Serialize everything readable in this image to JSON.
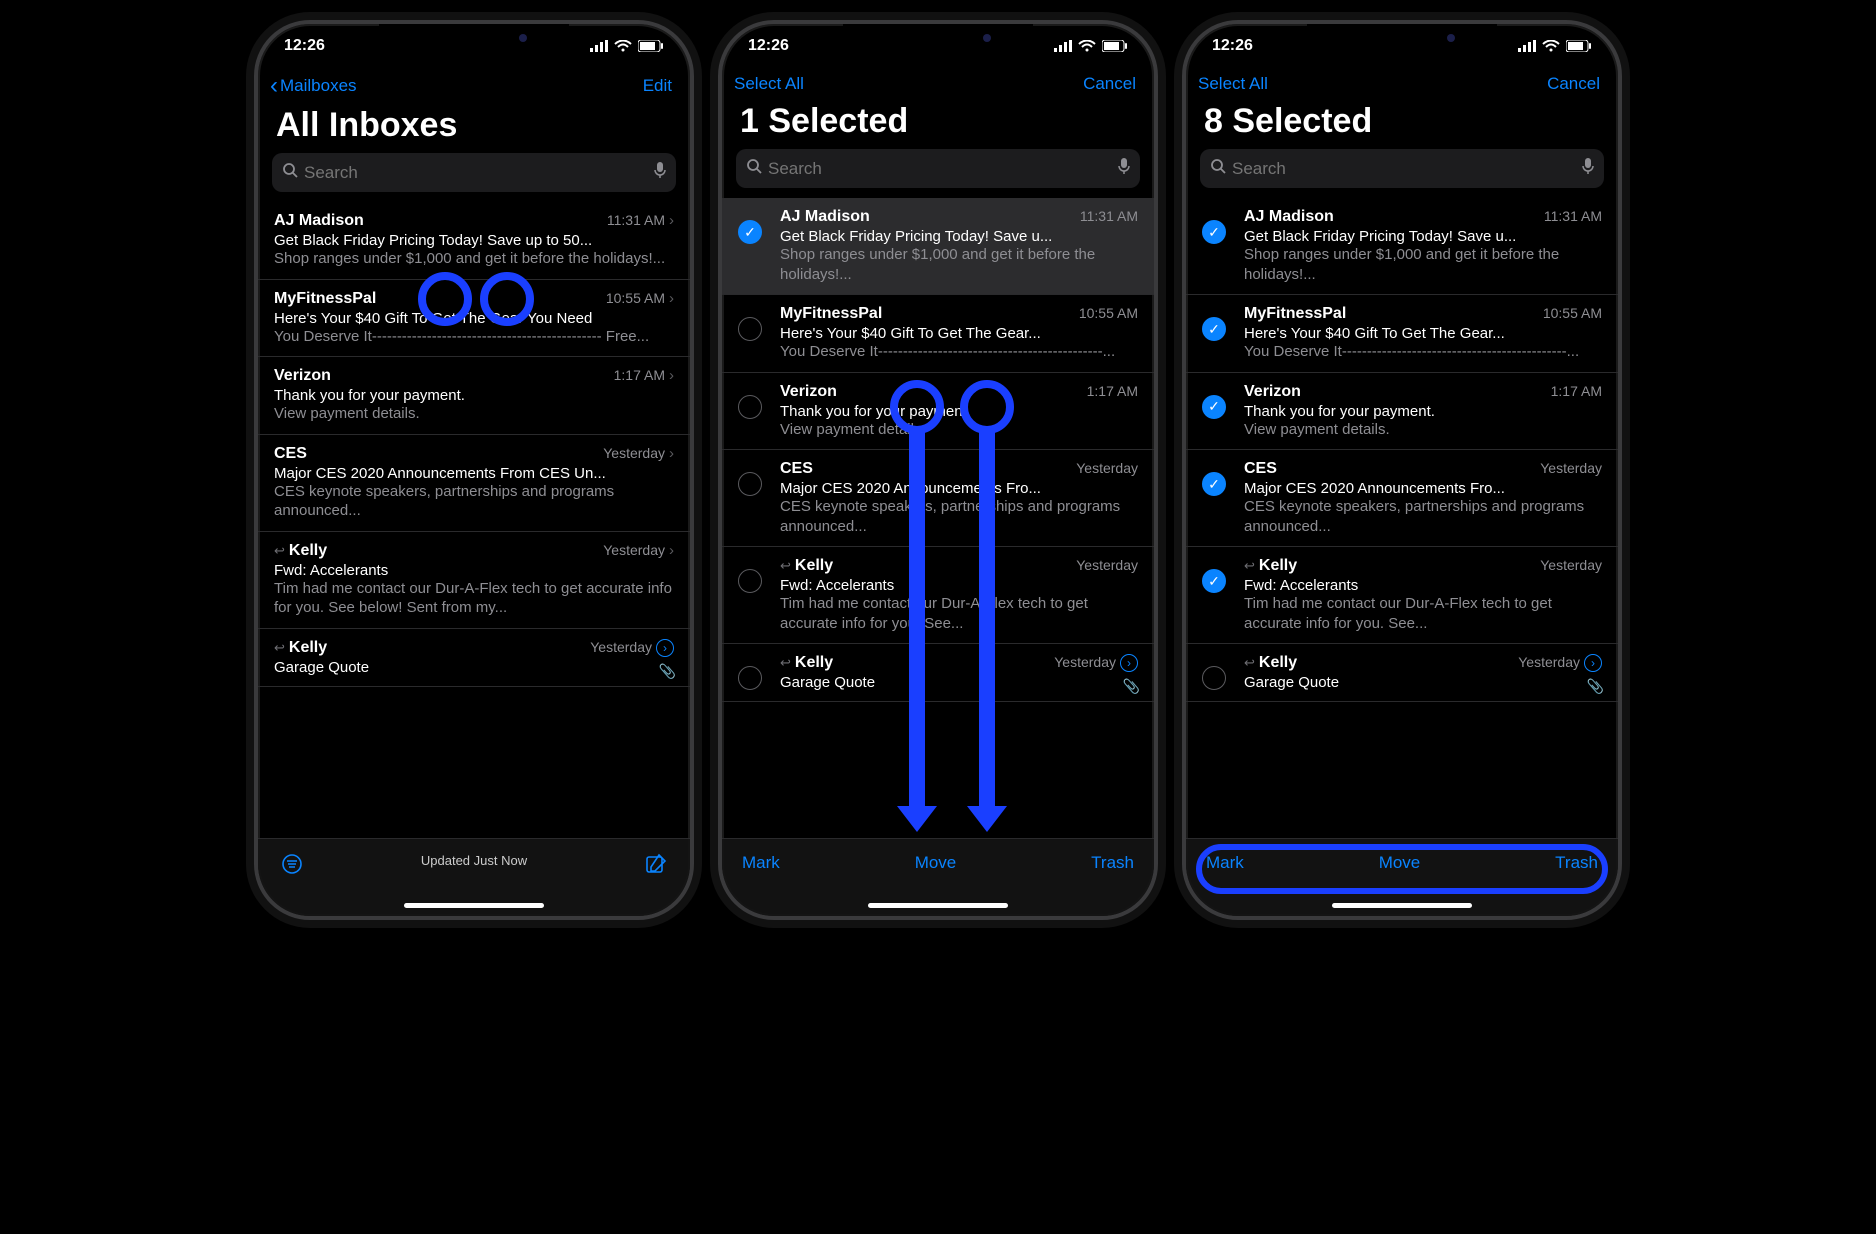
{
  "status": {
    "time": "12:26"
  },
  "search_placeholder": "Search",
  "phones": [
    {
      "nav": {
        "back": "Mailboxes",
        "right": "Edit",
        "show_chevron": true
      },
      "title": "All Inboxes",
      "mode": "browse",
      "toolbar": {
        "type": "status",
        "status": "Updated Just Now"
      },
      "annotations": {
        "two_circles": true
      },
      "emails": [
        {
          "sender": "AJ Madison",
          "time": "11:31 AM",
          "subject": "Get Black Friday Pricing Today! Save up to 50...",
          "preview": "Shop ranges under $1,000 and get it before the holidays!...",
          "disclosure": true
        },
        {
          "sender": "MyFitnessPal",
          "time": "10:55 AM",
          "subject": "Here's Your $40 Gift To Get The Gear You Need",
          "preview": "You Deserve It---------------------------------------------- Free...",
          "disclosure": true
        },
        {
          "sender": "Verizon",
          "time": "1:17 AM",
          "subject": "Thank you for your payment.",
          "preview": "View payment details.",
          "disclosure": true
        },
        {
          "sender": "CES",
          "time": "Yesterday",
          "subject": "Major CES 2020 Announcements From CES Un...",
          "preview": "CES keynote speakers, partnerships and programs announced...",
          "disclosure": true
        },
        {
          "sender": "Kelly",
          "time": "Yesterday",
          "subject": "Fwd: Accelerants",
          "preview": "Tim had me contact our Dur-A-Flex tech to get accurate info for you. See below! Sent from my...",
          "disclosure": true,
          "reply": true
        },
        {
          "sender": "Kelly",
          "time": "Yesterday",
          "subject": "Garage Quote",
          "preview": "",
          "thread": true,
          "reply": true,
          "attach": true
        }
      ]
    },
    {
      "nav": {
        "back": "Select All",
        "right": "Cancel",
        "show_chevron": false
      },
      "title": "1 Selected",
      "mode": "select",
      "toolbar": {
        "type": "actions",
        "left": "Mark",
        "center": "Move",
        "right": "Trash"
      },
      "annotations": {
        "two_arrows": true
      },
      "emails": [
        {
          "sender": "AJ Madison",
          "time": "11:31 AM",
          "subject": "Get Black Friday Pricing Today! Save u...",
          "preview": "Shop ranges under $1,000 and get it before the holidays!...",
          "checked": true,
          "highlight": true
        },
        {
          "sender": "MyFitnessPal",
          "time": "10:55 AM",
          "subject": "Here's Your $40 Gift To Get The Gear...",
          "preview": "You Deserve It---------------------------------------------...",
          "checked": false
        },
        {
          "sender": "Verizon",
          "time": "1:17 AM",
          "subject": "Thank you for your payment.",
          "preview": "View payment details.",
          "checked": false
        },
        {
          "sender": "CES",
          "time": "Yesterday",
          "subject": "Major CES 2020 Announcements Fro...",
          "preview": "CES keynote speakers, partnerships and programs announced...",
          "checked": false
        },
        {
          "sender": "Kelly",
          "time": "Yesterday",
          "subject": "Fwd: Accelerants",
          "preview": "Tim had me contact our Dur-A-Flex tech to get accurate info for you. See...",
          "checked": false,
          "reply": true
        },
        {
          "sender": "Kelly",
          "time": "Yesterday",
          "subject": "Garage Quote",
          "preview": "",
          "thread": true,
          "reply": true,
          "attach": true
        }
      ]
    },
    {
      "nav": {
        "back": "Select All",
        "right": "Cancel",
        "show_chevron": false
      },
      "title": "8 Selected",
      "mode": "select",
      "toolbar": {
        "type": "actions",
        "left": "Mark",
        "center": "Move",
        "right": "Trash"
      },
      "annotations": {
        "toolbar_pill": true
      },
      "emails": [
        {
          "sender": "AJ Madison",
          "time": "11:31 AM",
          "subject": "Get Black Friday Pricing Today! Save u...",
          "preview": "Shop ranges under $1,000 and get it before the holidays!...",
          "checked": true
        },
        {
          "sender": "MyFitnessPal",
          "time": "10:55 AM",
          "subject": "Here's Your $40 Gift To Get The Gear...",
          "preview": "You Deserve It---------------------------------------------...",
          "checked": true
        },
        {
          "sender": "Verizon",
          "time": "1:17 AM",
          "subject": "Thank you for your payment.",
          "preview": "View payment details.",
          "checked": true
        },
        {
          "sender": "CES",
          "time": "Yesterday",
          "subject": "Major CES 2020 Announcements Fro...",
          "preview": "CES keynote speakers, partnerships and programs announced...",
          "checked": true
        },
        {
          "sender": "Kelly",
          "time": "Yesterday",
          "subject": "Fwd: Accelerants",
          "preview": "Tim had me contact our Dur-A-Flex tech to get accurate info for you. See...",
          "checked": true,
          "reply": true
        },
        {
          "sender": "Kelly",
          "time": "Yesterday",
          "subject": "Garage Quote",
          "preview": "",
          "thread": true,
          "reply": true,
          "attach": true
        }
      ]
    }
  ]
}
